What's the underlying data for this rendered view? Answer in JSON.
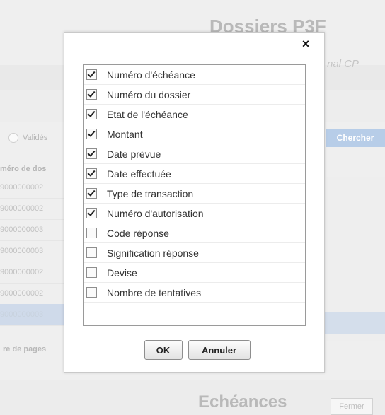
{
  "background": {
    "title": "Dossiers P3F",
    "subtitle": "nal CP",
    "filter_radio_label": "Validés",
    "search_button": "Chercher",
    "table_header": "méro de dos",
    "rows": [
      "9000000002",
      "9000000002",
      "9000000003",
      "9000000003",
      "9000000002",
      "9000000002",
      "9000000003"
    ],
    "pager_label": "re de pages",
    "bottom_title": "Echéances",
    "close_button": "Fermer"
  },
  "dialog": {
    "close_symbol": "×",
    "columns": [
      {
        "label": "Numéro d'échéance",
        "checked": true
      },
      {
        "label": "Numéro du dossier",
        "checked": true
      },
      {
        "label": "Etat de l'échéance",
        "checked": true
      },
      {
        "label": "Montant",
        "checked": true
      },
      {
        "label": "Date prévue",
        "checked": true
      },
      {
        "label": "Date effectuée",
        "checked": true
      },
      {
        "label": "Type de transaction",
        "checked": true
      },
      {
        "label": "Numéro d'autorisation",
        "checked": true
      },
      {
        "label": "Code réponse",
        "checked": false
      },
      {
        "label": "Signification réponse",
        "checked": false
      },
      {
        "label": "Devise",
        "checked": false
      },
      {
        "label": "Nombre de tentatives",
        "checked": false
      }
    ],
    "ok_label": "OK",
    "cancel_label": "Annuler"
  }
}
